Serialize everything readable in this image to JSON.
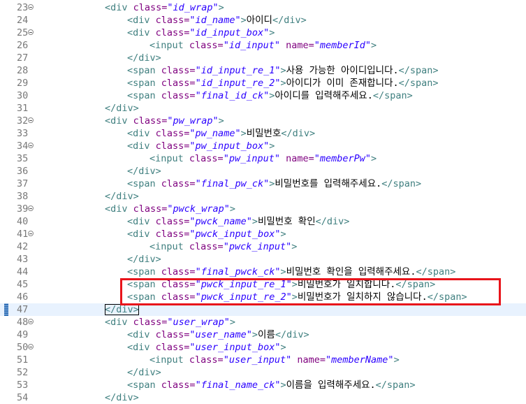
{
  "editor": {
    "highlight_color": "#e8141b",
    "lines": [
      {
        "n": "23",
        "indent": 1,
        "fold": true,
        "segs": [
          [
            "tag",
            "<div "
          ],
          [
            "attr",
            "class="
          ],
          [
            "val",
            "\"id_wrap\""
          ],
          [
            "tag",
            ">"
          ]
        ]
      },
      {
        "n": "24",
        "indent": 2,
        "segs": [
          [
            "tag",
            "<div "
          ],
          [
            "attr",
            "class="
          ],
          [
            "val",
            "\"id_name\""
          ],
          [
            "tag",
            ">"
          ],
          [
            "txt",
            "아이디"
          ],
          [
            "tag",
            "</div>"
          ]
        ]
      },
      {
        "n": "25",
        "indent": 2,
        "fold": true,
        "segs": [
          [
            "tag",
            "<div "
          ],
          [
            "attr",
            "class="
          ],
          [
            "val",
            "\"id_input_box\""
          ],
          [
            "tag",
            ">"
          ]
        ]
      },
      {
        "n": "26",
        "indent": 3,
        "segs": [
          [
            "tag",
            "<input "
          ],
          [
            "attr",
            "class="
          ],
          [
            "val",
            "\"id_input\""
          ],
          [
            "txt",
            " "
          ],
          [
            "attr",
            "name="
          ],
          [
            "val",
            "\"memberId\""
          ],
          [
            "tag",
            ">"
          ]
        ]
      },
      {
        "n": "27",
        "indent": 2,
        "segs": [
          [
            "tag",
            "</div>"
          ]
        ]
      },
      {
        "n": "28",
        "indent": 2,
        "segs": [
          [
            "tag",
            "<span "
          ],
          [
            "attr",
            "class="
          ],
          [
            "val",
            "\"id_input_re_1\""
          ],
          [
            "tag",
            ">"
          ],
          [
            "txt",
            "사용 가능한 아이디입니다."
          ],
          [
            "tag",
            "</span>"
          ]
        ]
      },
      {
        "n": "29",
        "indent": 2,
        "segs": [
          [
            "tag",
            "<span "
          ],
          [
            "attr",
            "class="
          ],
          [
            "val",
            "\"id_input_re_2\""
          ],
          [
            "tag",
            ">"
          ],
          [
            "txt",
            "아이디가 이미 존재합니다."
          ],
          [
            "tag",
            "</span>"
          ]
        ]
      },
      {
        "n": "30",
        "indent": 2,
        "segs": [
          [
            "tag",
            "<span "
          ],
          [
            "attr",
            "class="
          ],
          [
            "val",
            "\"final_id_ck\""
          ],
          [
            "tag",
            ">"
          ],
          [
            "txt",
            "아이디를 입력해주세요."
          ],
          [
            "tag",
            "</span>"
          ]
        ]
      },
      {
        "n": "31",
        "indent": 1,
        "segs": [
          [
            "tag",
            "</div>"
          ]
        ]
      },
      {
        "n": "32",
        "indent": 1,
        "fold": true,
        "segs": [
          [
            "tag",
            "<div "
          ],
          [
            "attr",
            "class="
          ],
          [
            "val",
            "\"pw_wrap\""
          ],
          [
            "tag",
            ">"
          ]
        ]
      },
      {
        "n": "33",
        "indent": 2,
        "segs": [
          [
            "tag",
            "<div "
          ],
          [
            "attr",
            "class="
          ],
          [
            "val",
            "\"pw_name\""
          ],
          [
            "tag",
            ">"
          ],
          [
            "txt",
            "비밀번호"
          ],
          [
            "tag",
            "</div>"
          ]
        ]
      },
      {
        "n": "34",
        "indent": 2,
        "fold": true,
        "segs": [
          [
            "tag",
            "<div "
          ],
          [
            "attr",
            "class="
          ],
          [
            "val",
            "\"pw_input_box\""
          ],
          [
            "tag",
            ">"
          ]
        ]
      },
      {
        "n": "35",
        "indent": 3,
        "segs": [
          [
            "tag",
            "<input "
          ],
          [
            "attr",
            "class="
          ],
          [
            "val",
            "\"pw_input\""
          ],
          [
            "txt",
            " "
          ],
          [
            "attr",
            "name="
          ],
          [
            "val",
            "\"memberPw\""
          ],
          [
            "tag",
            ">"
          ]
        ]
      },
      {
        "n": "36",
        "indent": 2,
        "segs": [
          [
            "tag",
            "</div>"
          ]
        ]
      },
      {
        "n": "37",
        "indent": 2,
        "segs": [
          [
            "tag",
            "<span "
          ],
          [
            "attr",
            "class="
          ],
          [
            "val",
            "\"final_pw_ck\""
          ],
          [
            "tag",
            ">"
          ],
          [
            "txt",
            "비밀번호를 입력해주세요."
          ],
          [
            "tag",
            "</span>"
          ]
        ]
      },
      {
        "n": "38",
        "indent": 1,
        "segs": [
          [
            "tag",
            "</div>"
          ]
        ]
      },
      {
        "n": "39",
        "indent": 1,
        "fold": true,
        "segs": [
          [
            "tag",
            "<div "
          ],
          [
            "attr",
            "class="
          ],
          [
            "val",
            "\"pwck_wrap\""
          ],
          [
            "tag",
            ">"
          ]
        ]
      },
      {
        "n": "40",
        "indent": 2,
        "segs": [
          [
            "tag",
            "<div "
          ],
          [
            "attr",
            "class="
          ],
          [
            "val",
            "\"pwck_name\""
          ],
          [
            "tag",
            ">"
          ],
          [
            "txt",
            "비밀번호 확인"
          ],
          [
            "tag",
            "</div>"
          ]
        ]
      },
      {
        "n": "41",
        "indent": 2,
        "fold": true,
        "segs": [
          [
            "tag",
            "<div "
          ],
          [
            "attr",
            "class="
          ],
          [
            "val",
            "\"pwck_input_box\""
          ],
          [
            "tag",
            ">"
          ]
        ]
      },
      {
        "n": "42",
        "indent": 3,
        "segs": [
          [
            "tag",
            "<input "
          ],
          [
            "attr",
            "class="
          ],
          [
            "val",
            "\"pwck_input\""
          ],
          [
            "tag",
            ">"
          ]
        ]
      },
      {
        "n": "43",
        "indent": 2,
        "segs": [
          [
            "tag",
            "</div>"
          ]
        ]
      },
      {
        "n": "44",
        "indent": 2,
        "segs": [
          [
            "tag",
            "<span "
          ],
          [
            "attr",
            "class="
          ],
          [
            "val",
            "\"final_pwck_ck\""
          ],
          [
            "tag",
            ">"
          ],
          [
            "txt",
            "비밀번호 확인을 입력해주세요."
          ],
          [
            "tag",
            "</span>"
          ]
        ]
      },
      {
        "n": "45",
        "indent": 2,
        "segs": [
          [
            "tag",
            "<span "
          ],
          [
            "attr",
            "class="
          ],
          [
            "val",
            "\"pwck_input_re_1\""
          ],
          [
            "tag",
            ">"
          ],
          [
            "txt",
            "비밀번호가 일치합니다."
          ],
          [
            "tag",
            "</span>"
          ]
        ]
      },
      {
        "n": "46",
        "indent": 2,
        "segs": [
          [
            "tag",
            "<span "
          ],
          [
            "attr",
            "class="
          ],
          [
            "val",
            "\"pwck_input_re_2\""
          ],
          [
            "tag",
            ">"
          ],
          [
            "txt",
            "비밀번호가 일치하지 않습니다."
          ],
          [
            "tag",
            "</span>"
          ]
        ]
      },
      {
        "n": "47",
        "indent": 1,
        "current": true,
        "marker": true,
        "segs": [
          [
            "tag",
            "</div>"
          ]
        ]
      },
      {
        "n": "48",
        "indent": 1,
        "fold": true,
        "segs": [
          [
            "tag",
            "<div "
          ],
          [
            "attr",
            "class="
          ],
          [
            "val",
            "\"user_wrap\""
          ],
          [
            "tag",
            ">"
          ]
        ]
      },
      {
        "n": "49",
        "indent": 2,
        "segs": [
          [
            "tag",
            "<div "
          ],
          [
            "attr",
            "class="
          ],
          [
            "val",
            "\"user_name\""
          ],
          [
            "tag",
            ">"
          ],
          [
            "txt",
            "이름"
          ],
          [
            "tag",
            "</div>"
          ]
        ]
      },
      {
        "n": "50",
        "indent": 2,
        "fold": true,
        "segs": [
          [
            "tag",
            "<div "
          ],
          [
            "attr",
            "class="
          ],
          [
            "val",
            "\"user_input_box\""
          ],
          [
            "tag",
            ">"
          ]
        ]
      },
      {
        "n": "51",
        "indent": 3,
        "segs": [
          [
            "tag",
            "<input "
          ],
          [
            "attr",
            "class="
          ],
          [
            "val",
            "\"user_input\""
          ],
          [
            "txt",
            " "
          ],
          [
            "attr",
            "name="
          ],
          [
            "val",
            "\"memberName\""
          ],
          [
            "tag",
            ">"
          ]
        ]
      },
      {
        "n": "52",
        "indent": 2,
        "segs": [
          [
            "tag",
            "</div>"
          ]
        ]
      },
      {
        "n": "53",
        "indent": 2,
        "segs": [
          [
            "tag",
            "<span "
          ],
          [
            "attr",
            "class="
          ],
          [
            "val",
            "\"final_name_ck\""
          ],
          [
            "tag",
            ">"
          ],
          [
            "txt",
            "이름을 입력해주세요."
          ],
          [
            "tag",
            "</span>"
          ]
        ]
      },
      {
        "n": "54",
        "indent": 1,
        "segs": [
          [
            "tag",
            "</div>"
          ]
        ]
      }
    ]
  }
}
